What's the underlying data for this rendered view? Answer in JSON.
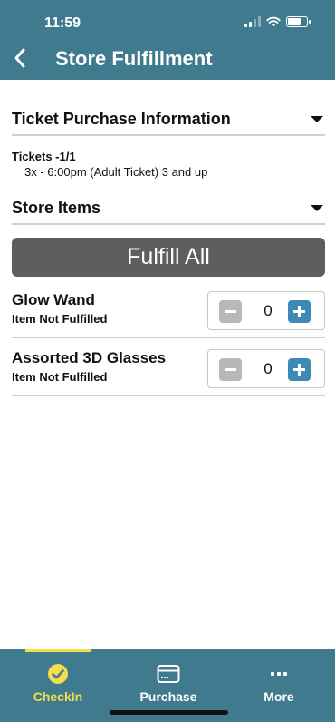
{
  "status_bar": {
    "time": "11:59"
  },
  "header": {
    "title": "Store Fulfillment",
    "back_icon": "chevron-left-icon"
  },
  "sections": {
    "ticket": {
      "label": "Ticket Purchase Information"
    },
    "store": {
      "label": "Store Items"
    }
  },
  "tickets": {
    "title": "Tickets -1/1",
    "line": "3x - 6:00pm (Adult Ticket) 3 and up"
  },
  "fulfill_all": {
    "label": "Fulfill All"
  },
  "items": [
    {
      "name": "Glow Wand",
      "status": "Item Not Fulfilled",
      "quantity": "0"
    },
    {
      "name": "Assorted 3D Glasses",
      "status": "Item Not Fulfilled",
      "quantity": "0"
    }
  ],
  "tabbar": {
    "tabs": [
      {
        "label": "CheckIn",
        "icon": "check-circle-icon",
        "active": true
      },
      {
        "label": "Purchase",
        "icon": "card-icon",
        "active": false
      },
      {
        "label": "More",
        "icon": "more-dots-icon",
        "active": false
      }
    ]
  },
  "colors": {
    "header": "#3f7a8f",
    "accent": "#f2dd4b",
    "plus": "#3d8ab6",
    "fulfill_button": "#5e5e5e"
  }
}
